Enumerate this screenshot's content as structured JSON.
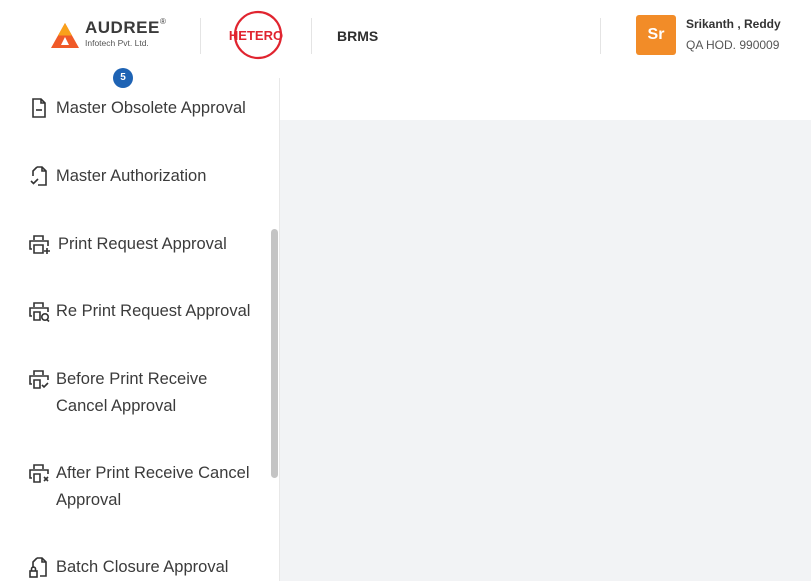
{
  "header": {
    "company_name": "AUDREE",
    "company_reg": "®",
    "company_subtitle": "Infotech Pvt. Ltd.",
    "client_logo_text": "HETERO",
    "app_name": "BRMS",
    "user": {
      "initials": "Sr",
      "name": "Srikanth , Reddy",
      "role": "QA HOD. 990009"
    }
  },
  "sidebar": {
    "badge_count": "5",
    "items": [
      {
        "label": "Master Obsolete Approval",
        "icon": "document-minus-icon"
      },
      {
        "label": "Master Authorization",
        "icon": "document-check-icon"
      },
      {
        "label": "Print Request Approval",
        "icon": "printer-plus-icon"
      },
      {
        "label": "Re Print Request Approval",
        "icon": "printer-refresh-icon"
      },
      {
        "label": "Before Print Receive Cancel Approval",
        "icon": "printer-check-icon"
      },
      {
        "label": "After Print Receive Cancel Approval",
        "icon": "printer-cancel-icon"
      },
      {
        "label": "Batch Closure Approval",
        "icon": "document-lock-icon"
      }
    ]
  },
  "colors": {
    "accent_orange": "#f28c28",
    "badge_blue": "#1e63b4",
    "hetero_red": "#e0242f",
    "content_bg": "#f2f3f5"
  }
}
